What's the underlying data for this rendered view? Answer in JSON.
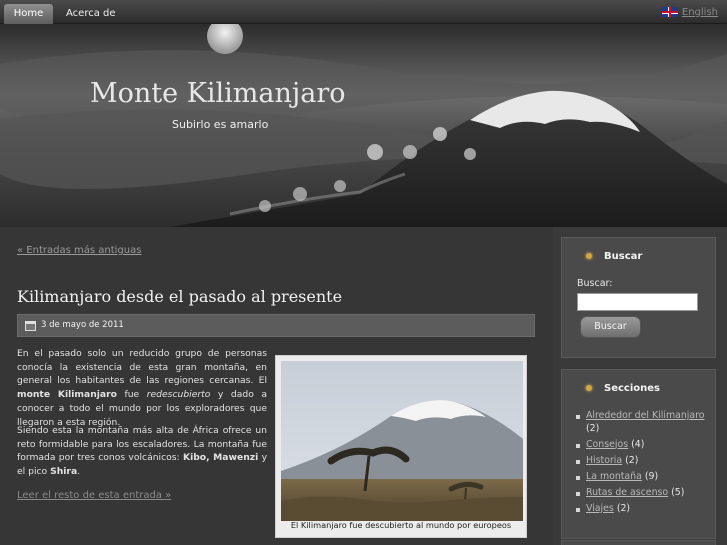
{
  "nav": {
    "home_label": "Home",
    "about_label": "Acerca de",
    "lang_label": "English"
  },
  "header": {
    "title": "Monte Kilimanjaro",
    "tagline": "Subirlo es amarlo"
  },
  "main": {
    "older_link": "« Entradas más antiguas",
    "post": {
      "title": "Kilimanjaro desde el pasado al presente",
      "date": "3 de mayo de 2011",
      "p1": [
        "En el pasado solo un reducido grupo de personas conocía la existencia de esta gran montaña, en general los habitantes de las regiones cercanas. El ",
        "monte Kilimanjaro",
        " fue ",
        "redescubierto",
        " y dado a conocer a todo el mundo por los exploradores que llegaron a esta región."
      ],
      "p2": [
        "Siendo esta la montaña más alta de África ofrece un reto formidable para los escaladores. La montaña fue formada por tres conos volcánicos: ",
        "Kibo, Mawenzi",
        " y el pico ",
        "Shira",
        "."
      ],
      "read_more": "Leer el resto de esta entrada »",
      "image_caption": "El Kilimanjaro fue descubierto al mundo por europeos"
    }
  },
  "sidebar": {
    "search": {
      "title": "Buscar",
      "label": "Buscar:",
      "value": "",
      "button": "Buscar"
    },
    "sections": {
      "title": "Secciones",
      "items": [
        {
          "label": "Alrededor del Kilimanjaro",
          "count": "(2)"
        },
        {
          "label": "Consejos",
          "count": "(4)"
        },
        {
          "label": "Historia",
          "count": "(2)"
        },
        {
          "label": "La montaña",
          "count": "(9)"
        },
        {
          "label": "Rutas de ascenso",
          "count": "(5)"
        },
        {
          "label": "Viajes",
          "count": "(2)"
        }
      ]
    }
  },
  "colors": {
    "background": "#3a3a3a",
    "meta_bar": "#5c5c5c",
    "widget": "#4a4a4a",
    "link": "#b8b8b8",
    "widget_icon": "#d6a640"
  },
  "icons": [
    "uk-flag-icon",
    "calendar-icon",
    "widget-bullet-icon"
  ]
}
